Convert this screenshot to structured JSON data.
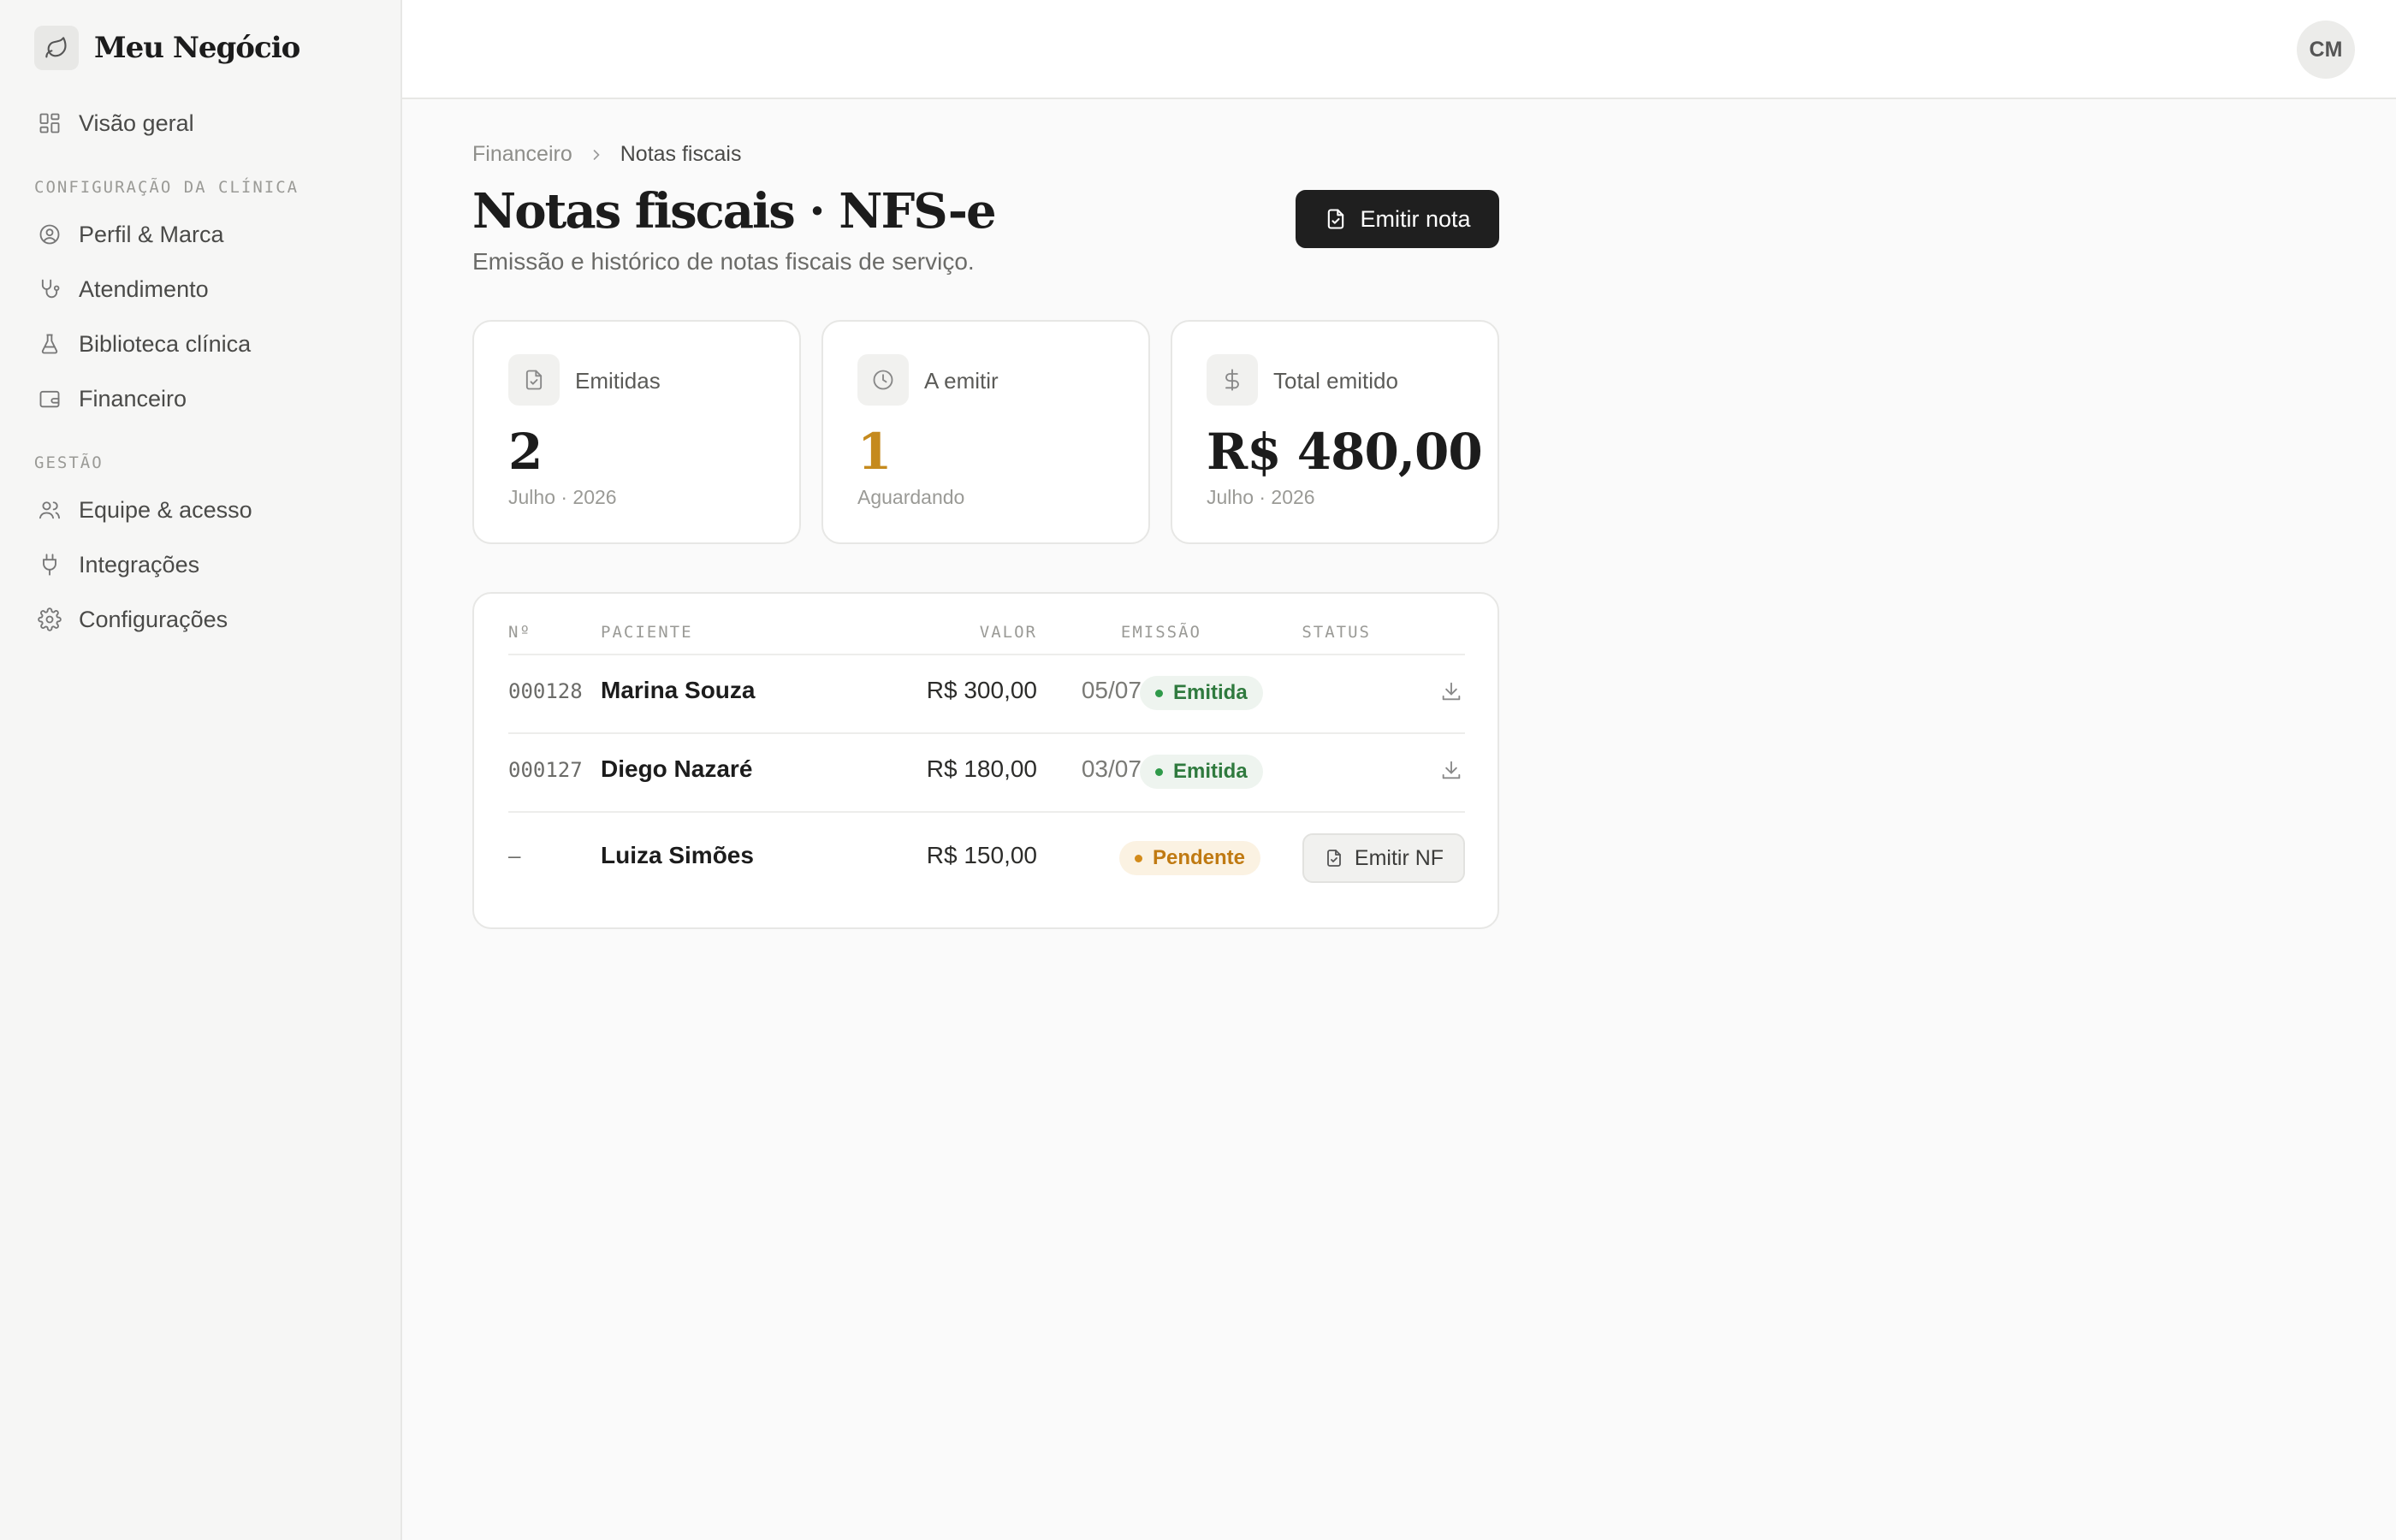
{
  "brand": {
    "name": "Meu Negócio"
  },
  "sidebar": {
    "top_item": {
      "label": "Visão geral",
      "icon": "dashboard-icon"
    },
    "section1": {
      "heading": "CONFIGURAÇÃO DA CLÍNICA",
      "items": [
        {
          "label": "Perfil & Marca",
          "icon": "user-circle-icon"
        },
        {
          "label": "Atendimento",
          "icon": "stethoscope-icon"
        },
        {
          "label": "Biblioteca clínica",
          "icon": "flask-icon"
        },
        {
          "label": "Financeiro",
          "icon": "wallet-icon"
        }
      ]
    },
    "section2": {
      "heading": "GESTÃO",
      "items": [
        {
          "label": "Equipe & acesso",
          "icon": "users-icon"
        },
        {
          "label": "Integrações",
          "icon": "plug-icon"
        },
        {
          "label": "Configurações",
          "icon": "gear-icon"
        }
      ]
    }
  },
  "topbar": {
    "avatar_initials": "CM"
  },
  "breadcrumb": {
    "parent": "Financeiro",
    "current": "Notas fiscais"
  },
  "page": {
    "title": "Notas fiscais · NFS-e",
    "subtitle": "Emissão e histórico de notas fiscais de serviço.",
    "primary_button": "Emitir nota"
  },
  "stats": [
    {
      "label": "Emitidas",
      "value": "2",
      "sub": "Julho · 2026",
      "icon": "file-check-icon"
    },
    {
      "label": "A emitir",
      "value": "1",
      "sub": "Aguardando",
      "icon": "clock-icon"
    },
    {
      "label": "Total emitido",
      "value": "R$ 480,00",
      "sub": "Julho · 2026",
      "icon": "dollar-icon"
    }
  ],
  "table": {
    "headers": {
      "num": "Nº",
      "patient": "PACIENTE",
      "value": "VALOR",
      "issued": "EMISSÃO",
      "status": "STATUS"
    },
    "rows": [
      {
        "num": "000128",
        "patient": "Marina Souza",
        "value": "R$ 300,00",
        "issued": "05/07/2026",
        "status": "Emitida"
      },
      {
        "num": "000127",
        "patient": "Diego Nazaré",
        "value": "R$ 180,00",
        "issued": "03/07/2026",
        "status": "Emitida"
      },
      {
        "num": "—",
        "patient": "Luiza Simões",
        "value": "R$ 150,00",
        "issued": "—",
        "status": "Pendente",
        "action": "Emitir NF"
      }
    ]
  },
  "colors": {
    "accent": "#c58a1e",
    "success": "#2f7a3e",
    "pending": "#c07a12",
    "primary_button": "#1f1f1f"
  }
}
